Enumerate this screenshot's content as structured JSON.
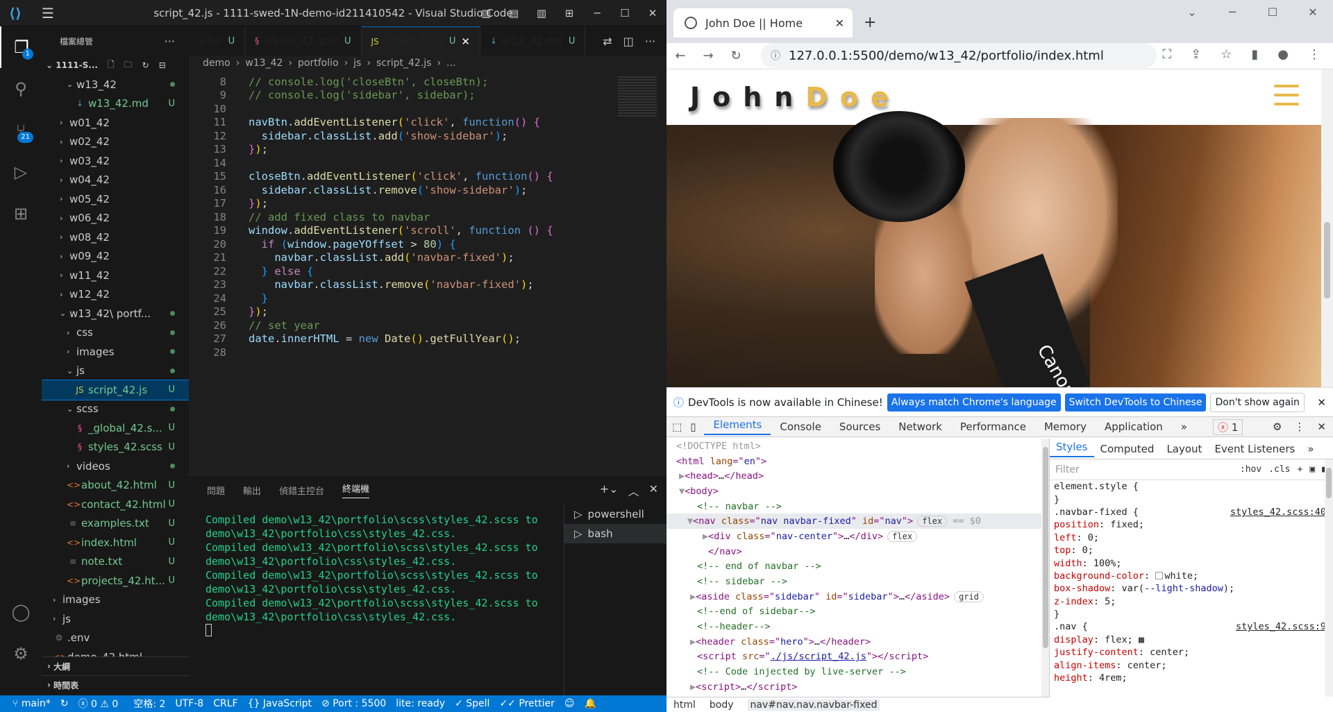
{
  "vscode": {
    "title": "script_42.js - 1111-swed-1N-demo-id211410542 - Visual Studio Code",
    "activity_badges": {
      "explorer": "1",
      "scm": "21"
    },
    "explorer_header": "檔案總管",
    "workspace": "1111-S...",
    "tree": [
      {
        "label": "w13_42",
        "indent": 36,
        "type": "folder-open",
        "dot": true
      },
      {
        "label": "w13_42.md",
        "indent": 46,
        "type": "md",
        "status": "U"
      },
      {
        "label": "w01_42",
        "indent": 26,
        "type": "folder"
      },
      {
        "label": "w02_42",
        "indent": 26,
        "type": "folder"
      },
      {
        "label": "w03_42",
        "indent": 26,
        "type": "folder"
      },
      {
        "label": "w04_42",
        "indent": 26,
        "type": "folder"
      },
      {
        "label": "w05_42",
        "indent": 26,
        "type": "folder"
      },
      {
        "label": "w06_42",
        "indent": 26,
        "type": "folder"
      },
      {
        "label": "w08_42",
        "indent": 26,
        "type": "folder"
      },
      {
        "label": "w09_42",
        "indent": 26,
        "type": "folder"
      },
      {
        "label": "w11_42",
        "indent": 26,
        "type": "folder"
      },
      {
        "label": "w12_42",
        "indent": 26,
        "type": "folder"
      },
      {
        "label": "w13_42\\ portf...",
        "indent": 26,
        "type": "folder-open",
        "dot": true
      },
      {
        "label": "css",
        "indent": 36,
        "type": "folder",
        "dot": true
      },
      {
        "label": "images",
        "indent": 36,
        "type": "folder",
        "dot": true
      },
      {
        "label": "js",
        "indent": 36,
        "type": "folder-open",
        "dot": true
      },
      {
        "label": "script_42.js",
        "indent": 46,
        "type": "js",
        "status": "U",
        "selected": true
      },
      {
        "label": "scss",
        "indent": 36,
        "type": "folder-open",
        "dot": true
      },
      {
        "label": "_global_42.s...",
        "indent": 46,
        "type": "scss",
        "status": "U"
      },
      {
        "label": "styles_42.scss",
        "indent": 46,
        "type": "scss",
        "status": "U"
      },
      {
        "label": "videos",
        "indent": 36,
        "type": "folder",
        "dot": true
      },
      {
        "label": "about_42.html",
        "indent": 36,
        "type": "html",
        "status": "U"
      },
      {
        "label": "contact_42.html",
        "indent": 36,
        "type": "html",
        "status": "U"
      },
      {
        "label": "examples.txt",
        "indent": 36,
        "type": "txt",
        "status": "U"
      },
      {
        "label": "index.html",
        "indent": 36,
        "type": "html",
        "status": "U"
      },
      {
        "label": "note.txt",
        "indent": 36,
        "type": "txt",
        "status": "U"
      },
      {
        "label": "projects_42.ht...",
        "indent": 36,
        "type": "html",
        "status": "U"
      },
      {
        "label": "images",
        "indent": 16,
        "type": "folder"
      },
      {
        "label": "js",
        "indent": 16,
        "type": "folder"
      },
      {
        "label": ".env",
        "indent": 16,
        "type": "env"
      },
      {
        "label": "demo_42.html",
        "indent": 16,
        "type": "html"
      }
    ],
    "outline_label": "大綱",
    "timeline_label": "時間表",
    "tabs": [
      {
        "label": "e.txt",
        "status": "U",
        "icon": "txt"
      },
      {
        "label": "styles_42.scss",
        "status": "U",
        "icon": "scss"
      },
      {
        "label": "script_42.js",
        "status": "U",
        "icon": "js",
        "active": true
      },
      {
        "label": "w13_42.md",
        "status": "U",
        "icon": "md"
      }
    ],
    "breadcrumb": [
      "demo",
      "w13_42",
      "portfolio",
      "js",
      "script_42.js",
      "..."
    ],
    "code_lines": [
      {
        "n": "8",
        "html": "<span class='cm'>// console.log('closeBtn', closeBtn);</span>"
      },
      {
        "n": "9",
        "html": "<span class='cm'>// console.log('sidebar', sidebar);</span>"
      },
      {
        "n": "10",
        "html": ""
      },
      {
        "n": "11",
        "html": "<span class='vr'>navBtn</span><span class='pn'>.</span><span class='fn'>addEventListener</span><span class='br'>(</span><span class='str'>'click'</span><span class='pn'>, </span><span class='kw'>function</span><span class='br2'>()</span><span class='pn'> </span><span class='br2'>{</span>"
      },
      {
        "n": "12",
        "html": "  <span class='vr'>sidebar</span><span class='pn'>.</span><span class='vr'>classList</span><span class='pn'>.</span><span class='fn'>add</span><span class='br3'>(</span><span class='str'>'show-sidebar'</span><span class='br3'>)</span><span class='pn'>;</span>"
      },
      {
        "n": "13",
        "html": "<span class='br2'>}</span><span class='br'>)</span><span class='pn'>;</span>"
      },
      {
        "n": "14",
        "html": ""
      },
      {
        "n": "15",
        "html": "<span class='vr'>closeBtn</span><span class='pn'>.</span><span class='fn'>addEventListener</span><span class='br'>(</span><span class='str'>'click'</span><span class='pn'>, </span><span class='kw'>function</span><span class='br2'>()</span><span class='pn'> </span><span class='br2'>{</span>"
      },
      {
        "n": "16",
        "html": "  <span class='vr'>sidebar</span><span class='pn'>.</span><span class='vr'>classList</span><span class='pn'>.</span><span class='fn'>remove</span><span class='br3'>(</span><span class='str'>'show-sidebar'</span><span class='br3'>)</span><span class='pn'>;</span>"
      },
      {
        "n": "17",
        "html": "<span class='br2'>}</span><span class='br'>)</span><span class='pn'>;</span>"
      },
      {
        "n": "18",
        "html": "<span class='cm'>// add fixed class to navbar</span>"
      },
      {
        "n": "19",
        "html": "<span class='vr'>window</span><span class='pn'>.</span><span class='fn'>addEventListener</span><span class='br'>(</span><span class='str'>'scroll'</span><span class='pn'>, </span><span class='kw'>function</span><span class='pn'> </span><span class='br2'>()</span><span class='pn'> </span><span class='br2'>{</span>"
      },
      {
        "n": "20",
        "html": "  <span class='pl'>if</span><span class='pn'> </span><span class='br3'>(</span><span class='vr'>window</span><span class='pn'>.</span><span class='vr'>pageYOffset</span><span class='pn'> &gt; </span><span class='num'>80</span><span class='br3'>)</span><span class='pn'> </span><span class='br3'>{</span>"
      },
      {
        "n": "21",
        "html": "    <span class='vr'>navbar</span><span class='pn'>.</span><span class='vr'>classList</span><span class='pn'>.</span><span class='fn'>add</span><span class='br'>(</span><span class='str'>'navbar-fixed'</span><span class='br'>)</span><span class='pn'>;</span>"
      },
      {
        "n": "22",
        "html": "  <span class='br3'>}</span><span class='pn'> </span><span class='pl'>else</span><span class='pn'> </span><span class='br3'>{</span>"
      },
      {
        "n": "23",
        "html": "    <span class='vr'>navbar</span><span class='pn'>.</span><span class='vr'>classList</span><span class='pn'>.</span><span class='fn'>remove</span><span class='br'>(</span><span class='str'>'navbar-fixed'</span><span class='br'>)</span><span class='pn'>;</span>"
      },
      {
        "n": "24",
        "html": "  <span class='br3'>}</span>"
      },
      {
        "n": "25",
        "html": "<span class='br2'>}</span><span class='br'>)</span><span class='pn'>;</span>"
      },
      {
        "n": "26",
        "html": "<span class='cm'>// set year</span>"
      },
      {
        "n": "27",
        "html": "<span class='vr'>date</span><span class='pn'>.</span><span class='vr'>innerHTML</span><span class='pn'> = </span><span class='kw'>new</span><span class='pn'> </span><span class='fn'>Date</span><span class='br'>()</span><span class='pn'>.</span><span class='fn'>getFullYear</span><span class='br'>()</span><span class='pn'>;</span>"
      },
      {
        "n": "28",
        "html": ""
      }
    ],
    "panel_tabs": [
      "問題",
      "輸出",
      "偵錯主控台",
      "終端機"
    ],
    "terminal_lines": [
      "Compiled demo\\w13_42\\portfolio\\scss\\styles_42.scss to",
      "demo\\w13_42\\portfolio\\css\\styles_42.css.",
      "Compiled demo\\w13_42\\portfolio\\scss\\styles_42.scss to",
      "demo\\w13_42\\portfolio\\css\\styles_42.css.",
      "Compiled demo\\w13_42\\portfolio\\scss\\styles_42.scss to",
      "demo\\w13_42\\portfolio\\css\\styles_42.css.",
      "Compiled demo\\w13_42\\portfolio\\scss\\styles_42.scss to",
      "demo\\w13_42\\portfolio\\css\\styles_42.css."
    ],
    "shells": [
      "powershell",
      "bash"
    ],
    "status": {
      "branch": "main*",
      "errors": "0",
      "warnings": "0",
      "spaces": "空格: 2",
      "encoding": "UTF-8",
      "eol": "CRLF",
      "language": "JavaScript",
      "port": "Port : 5500",
      "lite": "lite: ready",
      "spell": "Spell",
      "prettier": "Prettier"
    }
  },
  "chrome": {
    "tab_title": "John Doe || Home",
    "url": "127.0.0.1:5500/demo/w13_42/portfolio/index.html",
    "site_logo_a": "John",
    "site_logo_b": "Doe",
    "hero_text": "Canon",
    "infobar": {
      "text": "DevTools is now available in Chinese!",
      "btn1": "Always match Chrome's language",
      "btn2": "Switch DevTools to Chinese",
      "btn3": "Don't show again"
    },
    "dt_tabs": [
      "Elements",
      "Console",
      "Sources",
      "Network",
      "Performance",
      "Memory",
      "Application",
      "»"
    ],
    "error_count": "1",
    "elements": [
      {
        "html": "<span class='gr'>&lt;!DOCTYPE html&gt;</span>",
        "indent": 14
      },
      {
        "html": "<span class='tg'>&lt;html </span><span class='at'>lang</span><span class='tg'>=\"</span><span class='av'>en</span><span class='tg'>\"&gt;</span>",
        "indent": 14
      },
      {
        "html": "<span class='gr'>▶</span><span class='tg'>&lt;head&gt;</span><span class='tx'>…</span><span class='tg'>&lt;/head&gt;</span>",
        "indent": 18
      },
      {
        "html": "<span class='gr'>▼</span><span class='tg'>&lt;body&gt;</span>",
        "indent": 18
      },
      {
        "html": "<span class='cmt'>&lt;!-- navbar --&gt;</span>",
        "indent": 44
      },
      {
        "html": "<span class='gr'>▼</span><span class='tg'>&lt;nav </span><span class='at'>class</span><span class='tg'>=\"</span><span class='av'>nav navbar-fixed</span><span class='tg'>\" </span><span class='at'>id</span><span class='tg'>=\"</span><span class='av'>nav</span><span class='tg'>\"&gt;</span><span class='pill'>flex</span><span class='gr'> == $0</span>",
        "indent": 30,
        "sel": true
      },
      {
        "html": "<span class='gr'>▶</span><span class='tg'>&lt;div </span><span class='at'>class</span><span class='tg'>=\"</span><span class='av'>nav-center</span><span class='tg'>\"&gt;</span><span class='tx'>…</span><span class='tg'>&lt;/div&gt;</span><span class='pill'>flex</span>",
        "indent": 52
      },
      {
        "html": "<span class='tg'>&lt;/nav&gt;</span>",
        "indent": 60
      },
      {
        "html": "<span class='cmt'>&lt;!-- end of navbar --&gt;</span>",
        "indent": 44
      },
      {
        "html": "<span class='cmt'>&lt;!-- sidebar --&gt;</span>",
        "indent": 44
      },
      {
        "html": "<span class='gr'>▶</span><span class='tg'>&lt;aside </span><span class='at'>class</span><span class='tg'>=\"</span><span class='av'>sidebar</span><span class='tg'>\" </span><span class='at'>id</span><span class='tg'>=\"</span><span class='av'>sidebar</span><span class='tg'>\"&gt;</span><span class='tx'>…</span><span class='tg'>&lt;/aside&gt;</span><span class='pill'>grid</span>",
        "indent": 34
      },
      {
        "html": "<span class='cmt'>&lt;!--end of sidebar--&gt;</span>",
        "indent": 44
      },
      {
        "html": "<span class='cmt'>&lt;!--header--&gt;</span>",
        "indent": 44
      },
      {
        "html": "<span class='gr'>▶</span><span class='tg'>&lt;header </span><span class='at'>class</span><span class='tg'>=\"</span><span class='av'>hero</span><span class='tg'>\"&gt;</span><span class='tx'>…</span><span class='tg'>&lt;/header&gt;</span>",
        "indent": 34
      },
      {
        "html": "<span class='tg'>&lt;script </span><span class='at'>src</span><span class='tg'>=\"</span><span class='av' style='text-decoration:underline'>./js/script_42.js</span><span class='tg'>\"&gt;&lt;/script&gt;</span>",
        "indent": 44
      },
      {
        "html": "<span class='cmt'>&lt;!-- Code injected by live-server --&gt;</span>",
        "indent": 44
      },
      {
        "html": "<span class='gr'>▶</span><span class='tg'>&lt;script&gt;</span><span class='tx'>…</span><span class='tg'>&lt;/script&gt;</span>",
        "indent": 34
      }
    ],
    "styles_tabs": [
      "Styles",
      "Computed",
      "Layout",
      "Event Listeners",
      "»"
    ],
    "filter_placeholder": "Filter",
    "filter_hov": ":hov",
    "filter_cls": ".cls",
    "styles_rules": [
      {
        "html": "<span class='pv'>element.style {</span>"
      },
      {
        "html": "<span class='pv'>}</span>"
      },
      {
        "html": "<span class='pv'>.navbar-fixed {</span><span class='src'>styles_42.scss:40</span>"
      },
      {
        "html": "    <span class='pp'>position</span><span class='pv'>: fixed;</span>"
      },
      {
        "html": "    <span class='pp'>left</span><span class='pv'>: 0;</span>"
      },
      {
        "html": "    <span class='pp'>top</span><span class='pv'>: 0;</span>"
      },
      {
        "html": "    <span class='pp'>width</span><span class='pv'>: 100%;</span>"
      },
      {
        "html": "    <span class='pp'>background-color</span><span class='pv'>: <span class='sw' style='background:#fff'></span>white;</span>"
      },
      {
        "html": "    <span class='pp'>box-shadow</span><span class='pv'>: var(<span class='vv'>--light-shadow</span>);</span>"
      },
      {
        "html": "    <span class='pp'>z-index</span><span class='pv'>: 5;</span>"
      },
      {
        "html": "<span class='pv'>}</span>"
      },
      {
        "html": "<span class='pv'>.nav {</span><span class='src'>styles_42.scss:9</span>"
      },
      {
        "html": "    <span class='pp'>display</span><span class='pv'>: flex; ▦</span>"
      },
      {
        "html": "    <span class='pp'>justify-content</span><span class='pv'>: center;</span>"
      },
      {
        "html": "    <span class='pp'>align-items</span><span class='pv'>: center;</span>"
      },
      {
        "html": "    <span class='pp'>height</span><span class='pv'>: 4rem;</span>"
      }
    ],
    "crumbs": [
      "html",
      "body",
      "nav#nav.nav.navbar-fixed"
    ]
  }
}
